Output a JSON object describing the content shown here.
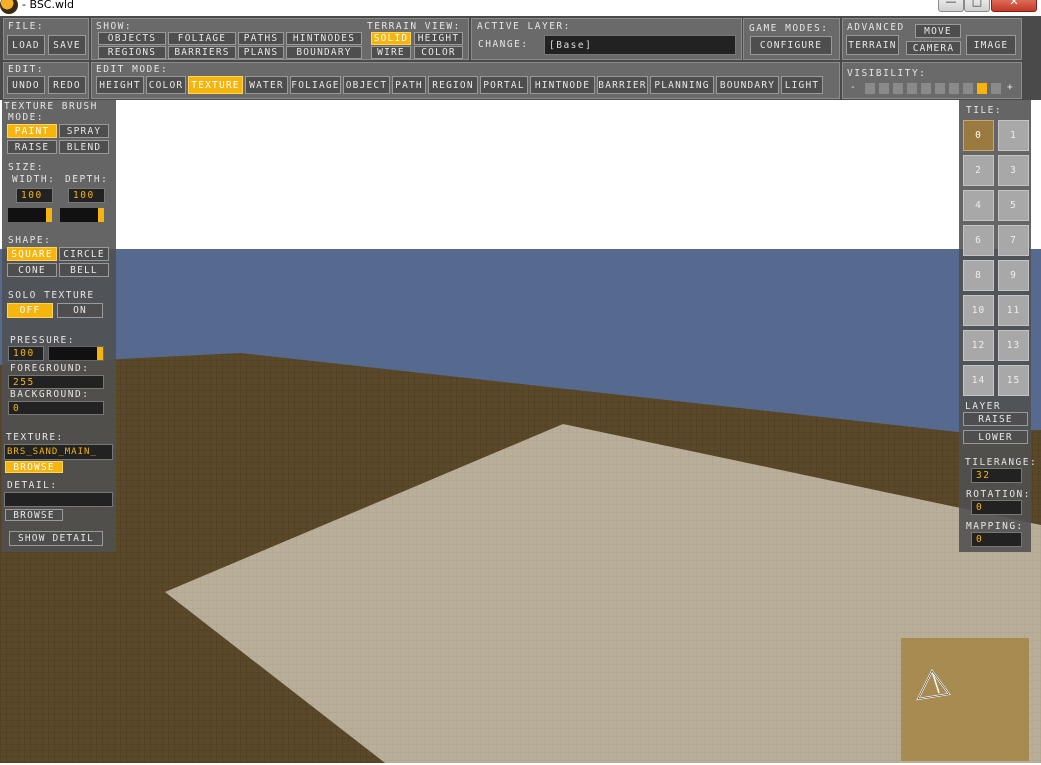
{
  "window": {
    "title": "- BSC.wld",
    "minimize": "—",
    "maximize": "□",
    "close": "✕"
  },
  "file": {
    "label": "File:",
    "load": "Load",
    "save": "Save"
  },
  "edit": {
    "label": "Edit:",
    "undo": "Undo",
    "redo": "Redo"
  },
  "show": {
    "label": "Show:",
    "items": [
      "Objects",
      "Foliage",
      "Paths",
      "HintNodes",
      "Regions",
      "Barriers",
      "Plans",
      "Boundary"
    ]
  },
  "terrain_view": {
    "label": "Terrain View:",
    "items": [
      "Solid",
      "Height",
      "Wire",
      "Color"
    ],
    "selected": "Solid"
  },
  "active_layer": {
    "label": "Active Layer:",
    "change": "Change:",
    "value": "[Base]"
  },
  "game_modes": {
    "label": "Game Modes:",
    "configure": "Configure"
  },
  "advanced": {
    "label": "Advanced",
    "terrain": "Terrain",
    "move": "Move",
    "camera": "Camera",
    "image": "Image"
  },
  "edit_mode": {
    "label": "Edit Mode:",
    "items": [
      "Height",
      "Color",
      "Texture",
      "Water",
      "Foliage",
      "Object",
      "Path",
      "Region",
      "Portal",
      "HintNode",
      "Barrier",
      "Planning",
      "Boundary",
      "Light"
    ],
    "selected": "Texture"
  },
  "visibility": {
    "label": "Visibility:",
    "minus": "-",
    "plus": "+",
    "level": 9,
    "steps": 10
  },
  "brush": {
    "title": "Texture Brush",
    "mode_label": "Mode:",
    "modes": [
      "Paint",
      "Spray",
      "Raise",
      "Blend"
    ],
    "mode_selected": "Paint",
    "size_label": "Size:",
    "width_label": "Width:",
    "depth_label": "Depth:",
    "width": "100",
    "depth": "100",
    "shape_label": "Shape:",
    "shapes": [
      "Square",
      "Circle",
      "Cone",
      "Bell"
    ],
    "shape_selected": "Square",
    "solo_label": "Solo Texture",
    "solo_off": "Off",
    "solo_on": "On",
    "pressure_label": "Pressure:",
    "pressure": "100",
    "foreground_label": "Foreground:",
    "foreground": "255",
    "background_label": "Background:",
    "background": "0",
    "texture_label": "Texture:",
    "texture": "BRS_SAND_MAIN_",
    "browse": "Browse",
    "detail_label": "Detail:",
    "detail": "",
    "browse2": "Browse",
    "show_detail": "Show Detail"
  },
  "tiles": {
    "label": "Tile:",
    "items": [
      "0",
      "1",
      "2",
      "3",
      "4",
      "5",
      "6",
      "7",
      "8",
      "9",
      "10",
      "11",
      "12",
      "13",
      "14",
      "15"
    ],
    "selected": "0",
    "layer_label": "Layer",
    "raise": "Raise",
    "lower": "Lower",
    "tilerange_label": "TileRange:",
    "tilerange": "32",
    "rotation_label": "Rotation:",
    "rotation": "0",
    "mapping_label": "Mapping:",
    "mapping": "0"
  },
  "colors": {
    "accent": "#f6b50e",
    "sky": "#566a8f",
    "ground": "#5c4a2a",
    "sand": "#b8ad98"
  }
}
